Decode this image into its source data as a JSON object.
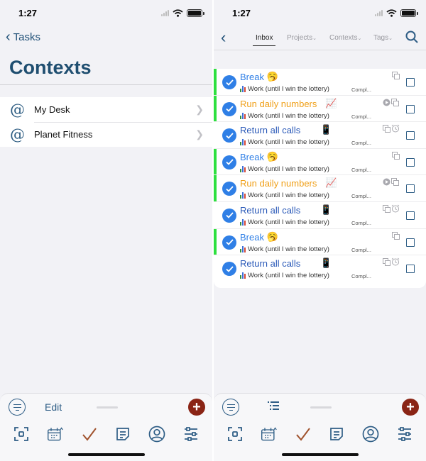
{
  "left": {
    "status_time": "1:27",
    "back_label": "Tasks",
    "title": "Contexts",
    "contexts": [
      {
        "icon": "@",
        "label": "My Desk"
      },
      {
        "icon": "@",
        "label": "Planet Fitness"
      }
    ],
    "toolbar": {
      "edit_label": "Edit",
      "add_symbol": "+"
    }
  },
  "right": {
    "status_time": "1:27",
    "tabs": [
      {
        "label": "Inbox",
        "active": true
      },
      {
        "label": "Projects",
        "active": false
      },
      {
        "label": "Contexts",
        "active": false
      },
      {
        "label": "Tags",
        "active": false
      }
    ],
    "caret": "⌄",
    "tasks": [
      {
        "title": "Break",
        "emoji": "🥱",
        "color": "#2f7fe6",
        "flag": true,
        "project": "Work (until I win the lottery)",
        "status": "Compl...",
        "icons": [
          "copy-icon"
        ]
      },
      {
        "title": "Run daily numbers",
        "emoji": "📈",
        "color": "#f0a019",
        "flag": true,
        "project": "Work (until I win the lottery)",
        "status": "Compl...",
        "icons": [
          "play-icon",
          "copy-icon"
        ]
      },
      {
        "title": "Return all calls",
        "emoji": "📱",
        "color": "#2a59b8",
        "flag": false,
        "project": "Work (until I win the lottery)",
        "status": "Compl...",
        "icons": [
          "copy-icon",
          "alarm-icon"
        ]
      },
      {
        "title": "Break",
        "emoji": "🥱",
        "color": "#2f7fe6",
        "flag": true,
        "project": "Work (until I win the lottery)",
        "status": "Compl...",
        "icons": [
          "copy-icon"
        ]
      },
      {
        "title": "Run daily numbers",
        "emoji": "📈",
        "color": "#f0a019",
        "flag": true,
        "project": "Work (until I win the lottery)",
        "status": "Compl...",
        "icons": [
          "play-icon",
          "copy-icon"
        ]
      },
      {
        "title": "Return all calls",
        "emoji": "📱",
        "color": "#2a59b8",
        "flag": false,
        "project": "Work (until I win the lottery)",
        "status": "Compl...",
        "icons": [
          "copy-icon",
          "alarm-icon"
        ]
      },
      {
        "title": "Break",
        "emoji": "🥱",
        "color": "#2f7fe6",
        "flag": true,
        "project": "Work (until I win the lottery)",
        "status": "Compl...",
        "icons": [
          "copy-icon"
        ]
      },
      {
        "title": "Return all calls",
        "emoji": "📱",
        "color": "#2a59b8",
        "flag": false,
        "project": "Work (until I win the lottery)",
        "status": "Compl...",
        "icons": [
          "copy-icon",
          "alarm-icon"
        ]
      }
    ],
    "toolbar": {
      "add_symbol": "+"
    }
  },
  "colors": {
    "accent": "#2f5e86",
    "title": "#1f4e70",
    "add_button": "#8a2415",
    "flag": "#2de03f",
    "check": "#2f7fe6"
  }
}
